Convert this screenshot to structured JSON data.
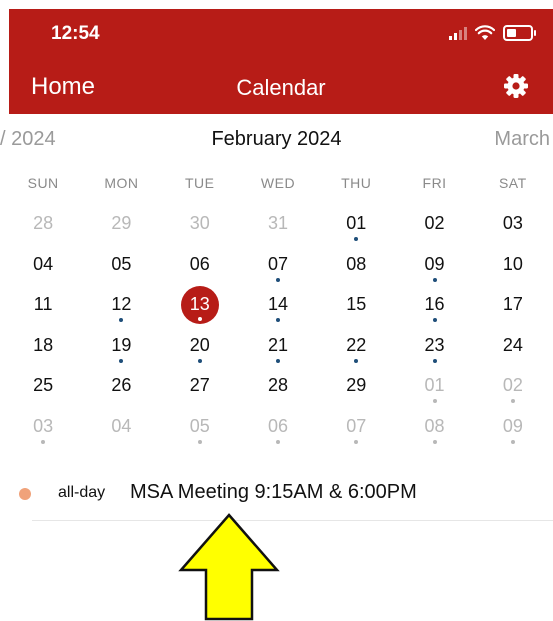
{
  "status_bar": {
    "time": "12:54"
  },
  "nav": {
    "home": "Home",
    "title": "Calendar"
  },
  "months": {
    "prev": "/ 2024",
    "current": "February 2024",
    "next": "March"
  },
  "weekdays": [
    "SUN",
    "MON",
    "TUE",
    "WED",
    "THU",
    "FRI",
    "SAT"
  ],
  "weeks": [
    [
      {
        "d": "28",
        "other": true
      },
      {
        "d": "29",
        "other": true
      },
      {
        "d": "30",
        "other": true
      },
      {
        "d": "31",
        "other": true
      },
      {
        "d": "01",
        "dot": true
      },
      {
        "d": "02"
      },
      {
        "d": "03"
      }
    ],
    [
      {
        "d": "04"
      },
      {
        "d": "05"
      },
      {
        "d": "06"
      },
      {
        "d": "07",
        "dot": true
      },
      {
        "d": "08"
      },
      {
        "d": "09",
        "dot": true
      },
      {
        "d": "10"
      }
    ],
    [
      {
        "d": "11"
      },
      {
        "d": "12",
        "dot": true
      },
      {
        "d": "13",
        "dot": true,
        "selected": true
      },
      {
        "d": "14",
        "dot": true
      },
      {
        "d": "15"
      },
      {
        "d": "16",
        "dot": true
      },
      {
        "d": "17"
      }
    ],
    [
      {
        "d": "18"
      },
      {
        "d": "19",
        "dot": true
      },
      {
        "d": "20",
        "dot": true
      },
      {
        "d": "21",
        "dot": true
      },
      {
        "d": "22",
        "dot": true
      },
      {
        "d": "23",
        "dot": true
      },
      {
        "d": "24"
      }
    ],
    [
      {
        "d": "25"
      },
      {
        "d": "26"
      },
      {
        "d": "27"
      },
      {
        "d": "28"
      },
      {
        "d": "29"
      },
      {
        "d": "01",
        "other": true,
        "dot": true
      },
      {
        "d": "02",
        "other": true,
        "dot": true
      }
    ],
    [
      {
        "d": "03",
        "other": true,
        "dot": true
      },
      {
        "d": "04",
        "other": true
      },
      {
        "d": "05",
        "other": true,
        "dot": true
      },
      {
        "d": "06",
        "other": true,
        "dot": true
      },
      {
        "d": "07",
        "other": true,
        "dot": true
      },
      {
        "d": "08",
        "other": true,
        "dot": true
      },
      {
        "d": "09",
        "other": true,
        "dot": true
      }
    ]
  ],
  "event": {
    "time": "all-day",
    "title": "MSA Meeting 9:15AM & 6:00PM",
    "color": "#f0a27a"
  },
  "colors": {
    "brand": "#b71c17",
    "event_dot": "#1f4e79",
    "arrow_fill": "#ffff00"
  },
  "icons": {
    "settings": "gear-icon",
    "arrow": "arrow-up-icon"
  }
}
